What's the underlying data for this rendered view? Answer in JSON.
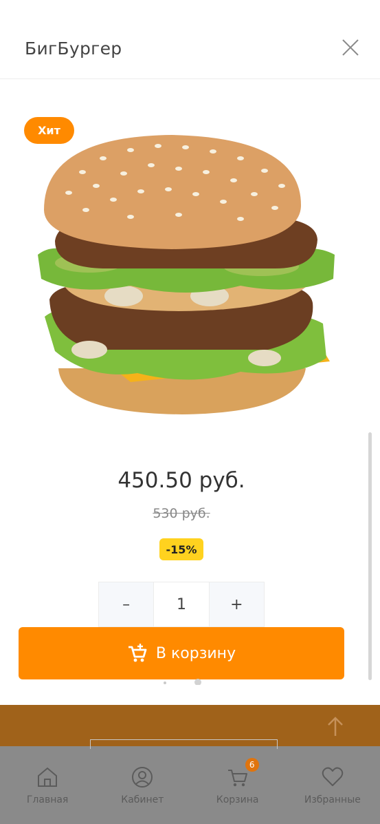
{
  "modal": {
    "title": "БигБургер",
    "badge": "Хит",
    "price": "450.50 руб.",
    "old_price": "530 руб.",
    "discount": "-15%",
    "quantity": "1",
    "qty_minus": "–",
    "qty_plus": "+",
    "add_to_cart_label": "В корзину"
  },
  "bottom_nav": {
    "items": [
      {
        "label": "Главная",
        "icon": "home-icon"
      },
      {
        "label": "Кабинет",
        "icon": "user-icon"
      },
      {
        "label": "Корзина",
        "icon": "cart-icon",
        "count": "6"
      },
      {
        "label": "Избранные",
        "icon": "heart-icon"
      }
    ]
  },
  "colors": {
    "accent": "#ff8a00",
    "discount_bg": "#ffd21f",
    "backdrop": "#a0621a",
    "overlay": "#8a8a8a"
  }
}
